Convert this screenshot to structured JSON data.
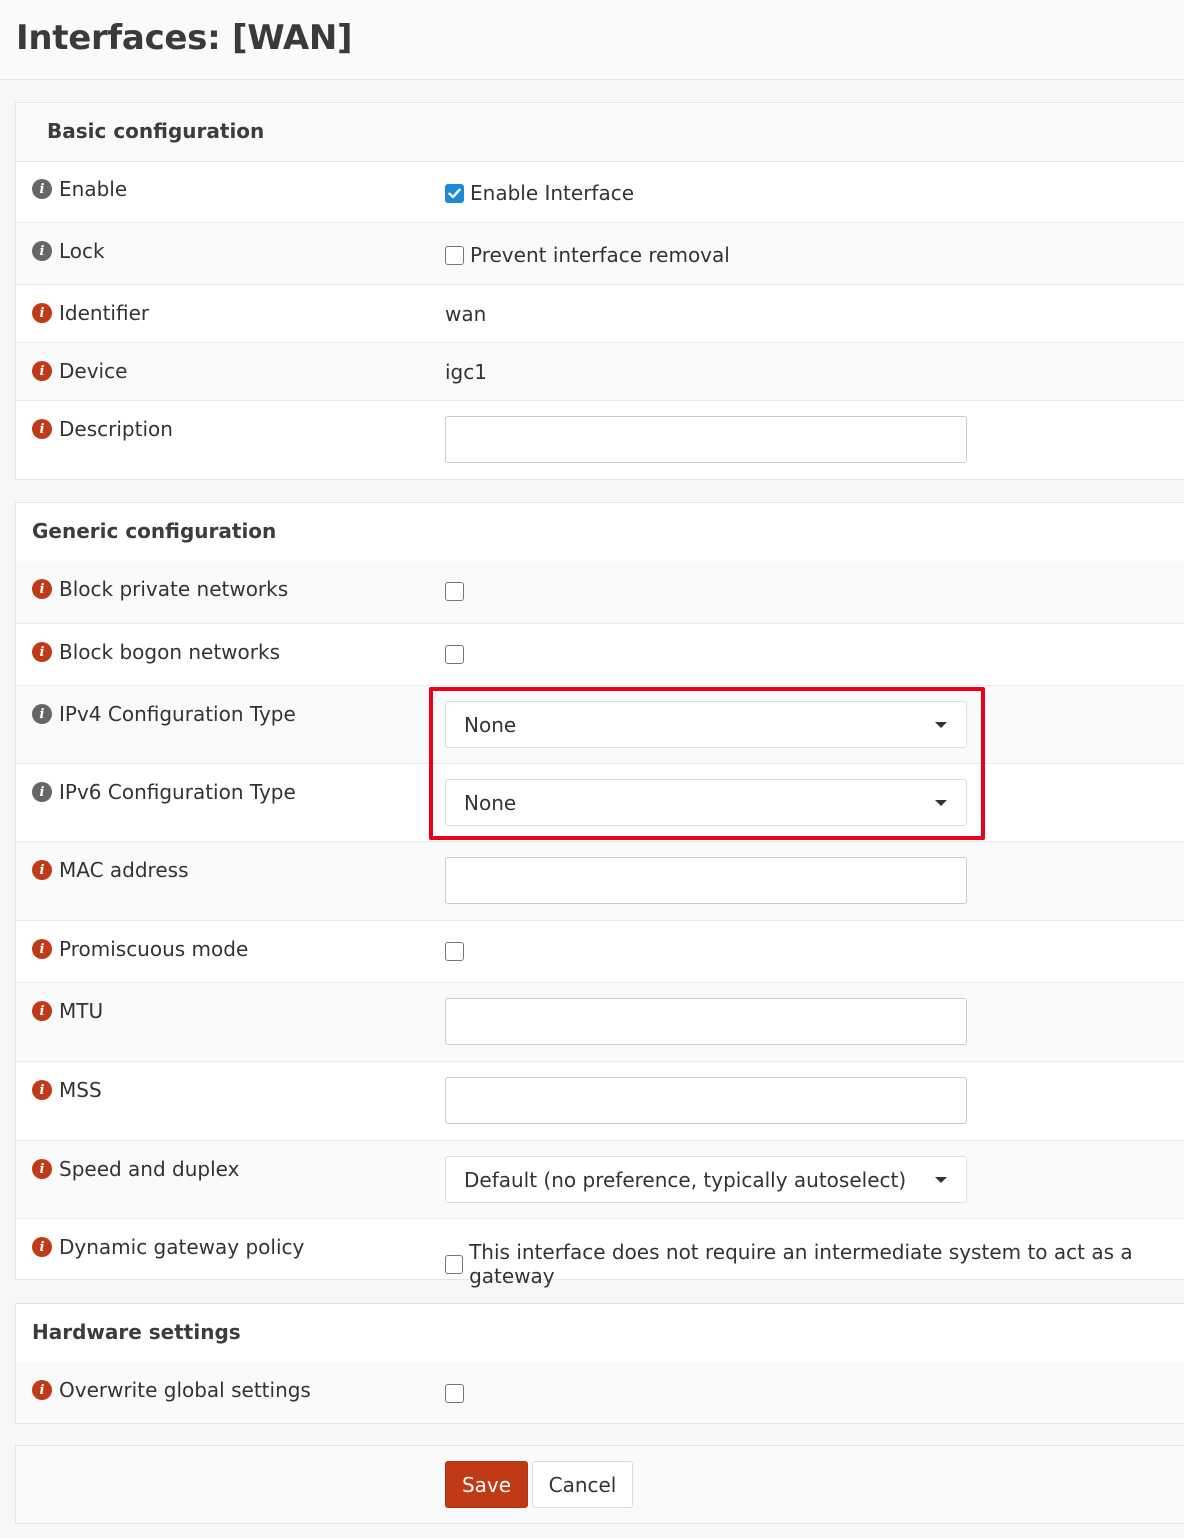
{
  "page": {
    "title": "Interfaces: [WAN]"
  },
  "basic": {
    "title": "Basic configuration",
    "enable": {
      "label": "Enable",
      "checkbox_label": "Enable Interface",
      "checked": true
    },
    "lock": {
      "label": "Lock",
      "checkbox_label": "Prevent interface removal",
      "checked": false
    },
    "identifier": {
      "label": "Identifier",
      "value": "wan"
    },
    "device": {
      "label": "Device",
      "value": "igc1"
    },
    "description": {
      "label": "Description",
      "value": ""
    }
  },
  "generic": {
    "title": "Generic configuration",
    "block_private": {
      "label": "Block private networks",
      "checked": false
    },
    "block_bogon": {
      "label": "Block bogon networks",
      "checked": false
    },
    "ipv4_type": {
      "label": "IPv4 Configuration Type",
      "selected": "None"
    },
    "ipv6_type": {
      "label": "IPv6 Configuration Type",
      "selected": "None"
    },
    "mac": {
      "label": "MAC address",
      "value": ""
    },
    "promiscuous": {
      "label": "Promiscuous mode",
      "checked": false
    },
    "mtu": {
      "label": "MTU",
      "value": ""
    },
    "mss": {
      "label": "MSS",
      "value": ""
    },
    "speed": {
      "label": "Speed and duplex",
      "selected": "Default (no preference, typically autoselect)"
    },
    "gateway_policy": {
      "label": "Dynamic gateway policy",
      "checkbox_label": "This interface does not require an intermediate system to act as a gateway",
      "checked": false
    }
  },
  "hardware": {
    "title": "Hardware settings",
    "overwrite": {
      "label": "Overwrite global settings",
      "checked": false
    }
  },
  "actions": {
    "save_label": "Save",
    "cancel_label": "Cancel"
  },
  "colors": {
    "accent": "#c03a17",
    "checkbox_checked": "#1f8ad2",
    "highlight_box": "#e8001c",
    "info_gray": "#666666"
  }
}
